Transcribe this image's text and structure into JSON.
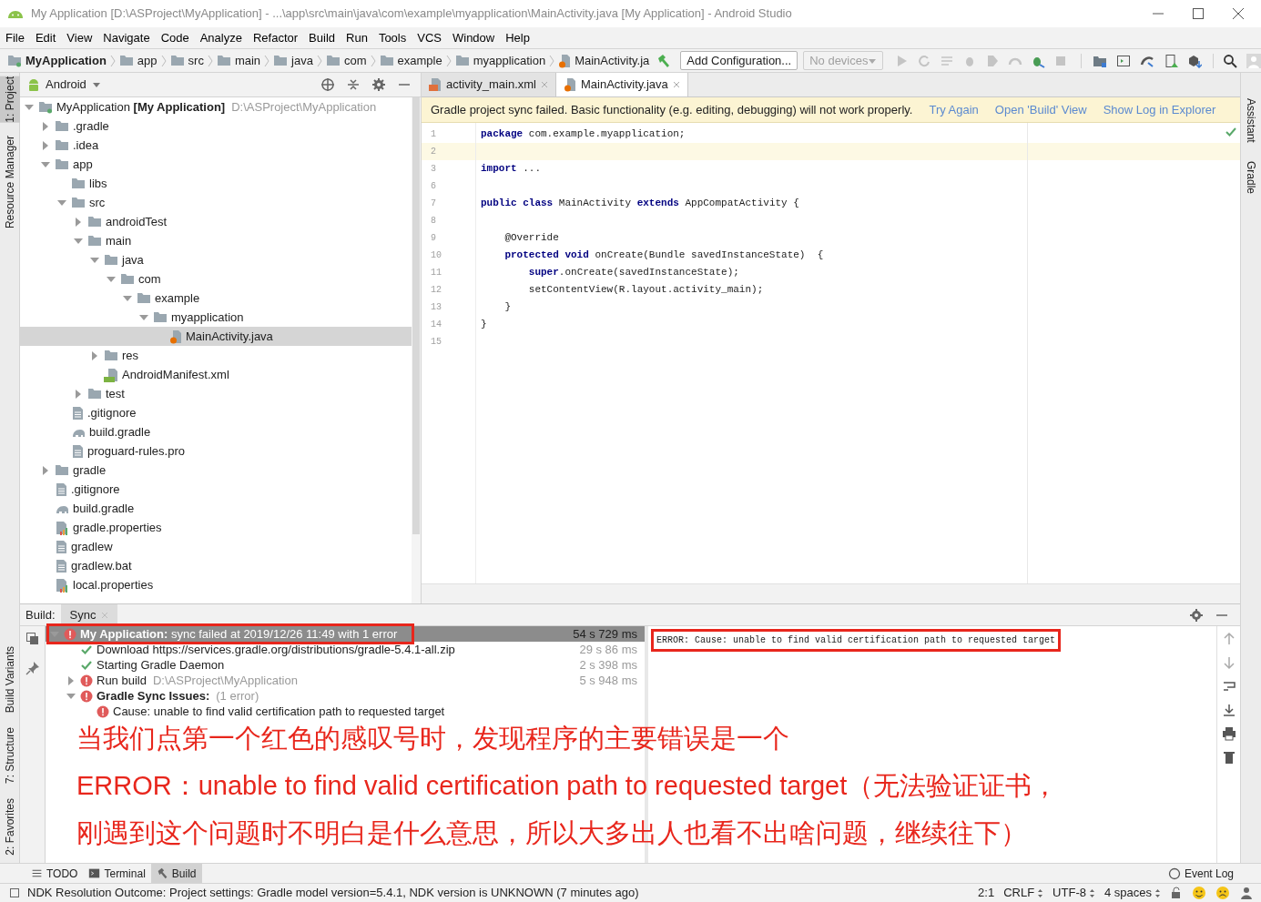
{
  "window": {
    "title": "My Application [D:\\ASProject\\MyApplication] - ...\\app\\src\\main\\java\\com\\example\\myapplication\\MainActivity.java [My Application] - Android Studio"
  },
  "menu": [
    "File",
    "Edit",
    "View",
    "Navigate",
    "Code",
    "Analyze",
    "Refactor",
    "Build",
    "Run",
    "Tools",
    "VCS",
    "Window",
    "Help"
  ],
  "breadcrumbs": [
    {
      "label": "MyApplication",
      "kind": "project"
    },
    {
      "label": "app",
      "kind": "folder"
    },
    {
      "label": "src",
      "kind": "folder"
    },
    {
      "label": "main",
      "kind": "folder"
    },
    {
      "label": "java",
      "kind": "folder"
    },
    {
      "label": "com",
      "kind": "folder"
    },
    {
      "label": "example",
      "kind": "folder"
    },
    {
      "label": "myapplication",
      "kind": "folder"
    },
    {
      "label": "MainActivity.ja",
      "kind": "java"
    }
  ],
  "toolbar": {
    "config_button": "Add Configuration...",
    "device_select": "No devices"
  },
  "left_strip": {
    "top": [
      {
        "label": "1: Project",
        "selected": true
      },
      {
        "label": "Resource Manager",
        "selected": false
      }
    ],
    "bottom": [
      {
        "label": "Build Variants",
        "selected": false
      },
      {
        "label": "7: Structure",
        "selected": false
      },
      {
        "label": "2: Favorites",
        "selected": false
      }
    ]
  },
  "right_strip": [
    "Assistant",
    "Gradle"
  ],
  "project_panel": {
    "view": "Android",
    "tree": [
      {
        "label": "MyApplication **[My Application]**",
        "path": "D:\\ASProject\\MyApplication",
        "kind": "module",
        "expanded": true,
        "selected": false,
        "children": [
          {
            "label": ".gradle",
            "kind": "folder",
            "expanded": false,
            "selected": false
          },
          {
            "label": ".idea",
            "kind": "folder",
            "expanded": false,
            "selected": false
          },
          {
            "label": "app",
            "kind": "folder",
            "expanded": true,
            "selected": false,
            "children": [
              {
                "label": "libs",
                "kind": "folder",
                "selected": false
              },
              {
                "label": "src",
                "kind": "folder",
                "expanded": true,
                "selected": false,
                "children": [
                  {
                    "label": "androidTest",
                    "kind": "folder",
                    "expanded": false,
                    "selected": false
                  },
                  {
                    "label": "main",
                    "kind": "folder",
                    "expanded": true,
                    "selected": false,
                    "children": [
                      {
                        "label": "java",
                        "kind": "folder",
                        "expanded": true,
                        "selected": false,
                        "children": [
                          {
                            "label": "com",
                            "kind": "folder",
                            "expanded": true,
                            "selected": false,
                            "children": [
                              {
                                "label": "example",
                                "kind": "folder",
                                "expanded": true,
                                "selected": false,
                                "children": [
                                  {
                                    "label": "myapplication",
                                    "kind": "folder",
                                    "expanded": true,
                                    "selected": false,
                                    "children": [
                                      {
                                        "label": "MainActivity.java",
                                        "kind": "java",
                                        "selected": true
                                      }
                                    ]
                                  }
                                ]
                              }
                            ]
                          }
                        ]
                      },
                      {
                        "label": "res",
                        "kind": "folder",
                        "expanded": false,
                        "selected": false
                      },
                      {
                        "label": "AndroidManifest.xml",
                        "kind": "manifest",
                        "selected": false
                      }
                    ]
                  },
                  {
                    "label": "test",
                    "kind": "folder",
                    "expanded": false,
                    "selected": false
                  }
                ]
              },
              {
                "label": ".gitignore",
                "kind": "text",
                "selected": false
              },
              {
                "label": "build.gradle",
                "kind": "gradle",
                "selected": false
              },
              {
                "label": "proguard-rules.pro",
                "kind": "text",
                "selected": false
              }
            ]
          },
          {
            "label": "gradle",
            "kind": "folder",
            "expanded": false,
            "selected": false
          },
          {
            "label": ".gitignore",
            "kind": "text",
            "selected": false
          },
          {
            "label": "build.gradle",
            "kind": "gradle",
            "selected": false
          },
          {
            "label": "gradle.properties",
            "kind": "properties",
            "selected": false
          },
          {
            "label": "gradlew",
            "kind": "text",
            "selected": false
          },
          {
            "label": "gradlew.bat",
            "kind": "text",
            "selected": false
          },
          {
            "label": "local.properties",
            "kind": "properties",
            "selected": false
          }
        ]
      }
    ]
  },
  "editor": {
    "tabs": [
      {
        "label": "activity_main.xml",
        "kind": "xml",
        "selected": false
      },
      {
        "label": "MainActivity.java",
        "kind": "java",
        "selected": true
      }
    ],
    "banner": {
      "message": "Gradle project sync failed. Basic functionality (e.g. editing, debugging) will not work properly.",
      "actions": [
        "Try Again",
        "Open 'Build' View",
        "Show Log in Explorer"
      ]
    },
    "lines": [
      {
        "number": "1",
        "code": "**package** com.example.myapplication;",
        "current": false
      },
      {
        "number": "2",
        "current": true
      },
      {
        "number": "3",
        "code": "**import** ...",
        "current": false
      },
      {
        "number": "6",
        "current": false
      },
      {
        "number": "7",
        "code": "**public class** MainActivity **extends** AppCompatActivity {",
        "current": false
      },
      {
        "number": "8",
        "current": false
      },
      {
        "number": "9",
        "code": "    @Override",
        "current": false
      },
      {
        "number": "10",
        "code": "    **protected void** onCreate(Bundle savedInstanceState)  {",
        "current": false
      },
      {
        "number": "11",
        "code": "        **super**.onCreate(savedInstanceState);",
        "current": false
      },
      {
        "number": "12",
        "code": "        setContentView(R.layout.activity_main);",
        "current": false
      },
      {
        "number": "13",
        "code": "    }",
        "current": false
      },
      {
        "number": "14",
        "code": "}",
        "current": false
      },
      {
        "number": "15",
        "current": false
      }
    ]
  },
  "build_panel": {
    "label": "Build:",
    "tabs": [
      {
        "label": "Sync",
        "selected": true
      }
    ],
    "tree": [
      {
        "kind": "error",
        "label": "**My Application:** sync failed at 2019/12/26 11:49  with 1 error",
        "time": "54 s 729 ms",
        "expanded": true,
        "selected": true,
        "highlighted": true,
        "children": [
          {
            "kind": "success",
            "label": "Download https://services.gradle.org/distributions/gradle-5.4.1-all.zip",
            "time": "29 s 86 ms",
            "selected": false,
            "highlighted": false
          },
          {
            "kind": "success",
            "label": "Starting Gradle Daemon",
            "time": "2 s 398 ms",
            "selected": false,
            "highlighted": false
          },
          {
            "kind": "error",
            "label": "Run build",
            "detail": "D:\\ASProject\\MyApplication",
            "time": "5 s 948 ms",
            "expanded": false,
            "selected": false,
            "highlighted": false
          },
          {
            "kind": "error",
            "label": "Gradle Sync Issues:",
            "detail": "(1 error)",
            "expanded": true,
            "selected": false,
            "highlighted": false,
            "children": [
              {
                "kind": "error",
                "label": "Cause: unable to find valid certification path to requested target",
                "selected": false,
                "highlighted": false
              }
            ]
          }
        ]
      }
    ],
    "output": {
      "text": "ERROR: Cause: unable to find valid certification path to requested target",
      "highlighted": true
    }
  },
  "annotation": [
    "当我们点第一个红色的感叹号时，发现程序的主要错误是一个",
    "ERROR：unable to find valid certification path to requested target（无法验证证书，",
    "刚遇到这个问题时不明白是什么意思，所以大多出人也看不出啥问题，继续往下）"
  ],
  "tool_windows": [
    {
      "label": "TODO",
      "kind": "todo",
      "selected": false
    },
    {
      "label": "Terminal",
      "kind": "terminal",
      "selected": false
    },
    {
      "label": "Build",
      "kind": "build",
      "selected": true
    }
  ],
  "event_log": "Event Log",
  "status_bar": {
    "message": "NDK Resolution Outcome: Project settings: Gradle model version=5.4.1, NDK version is UNKNOWN (7 minutes ago)",
    "items": [
      {
        "label": "2:1",
        "kind": "text"
      },
      {
        "label": "CRLF",
        "kind": "select"
      },
      {
        "label": "UTF-8",
        "kind": "select"
      },
      {
        "label": "4 spaces",
        "kind": "select"
      }
    ]
  }
}
